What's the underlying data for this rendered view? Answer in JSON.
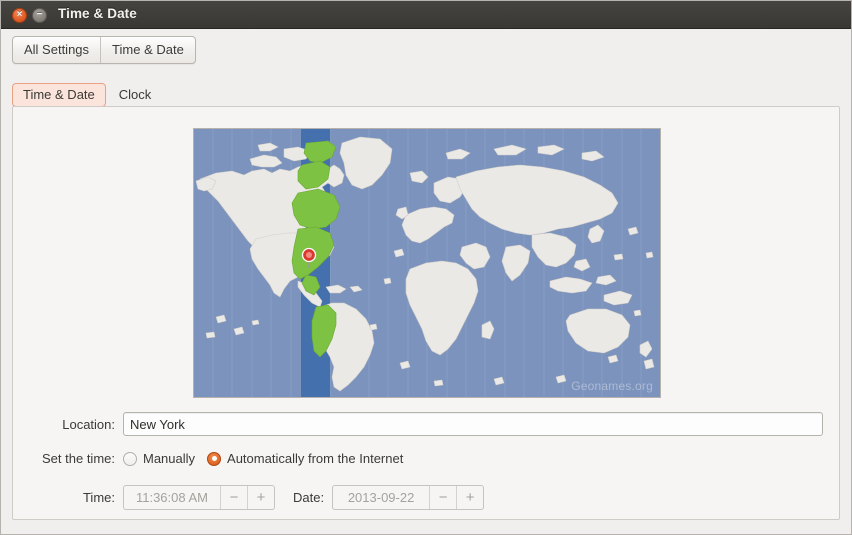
{
  "window": {
    "title": "Time & Date",
    "close_icon": "close-icon",
    "close_glyph": "×",
    "minimize_icon": "minimize-icon",
    "minimize_glyph": "−"
  },
  "toolbar": {
    "buttons": [
      {
        "label": "All Settings"
      },
      {
        "label": "Time & Date"
      }
    ]
  },
  "tabs": [
    {
      "label": "Time & Date",
      "active": true
    },
    {
      "label": "Clock",
      "active": false
    }
  ],
  "map": {
    "attribution": "Geonames.org",
    "ocean_color": "#7b93bd",
    "land_color": "#ebe9e6",
    "highlight_color": "#7dc242",
    "selected_band_color": "#3f6cab",
    "pin_color": "#e8443c",
    "marker_name": "location-pin"
  },
  "location": {
    "label": "Location:",
    "value": "New York",
    "placeholder": ""
  },
  "set_time": {
    "label": "Set the time:",
    "options": [
      {
        "label": "Manually",
        "selected": false
      },
      {
        "label": "Automatically from the Internet",
        "selected": true
      }
    ],
    "accent_color": "#e06a2a"
  },
  "time_row": {
    "time_label": "Time:",
    "time_value": "11:36:08 AM",
    "date_label": "Date:",
    "date_value": "2013-09-22",
    "minus_glyph": "−",
    "plus_glyph": "+",
    "disabled": true
  }
}
